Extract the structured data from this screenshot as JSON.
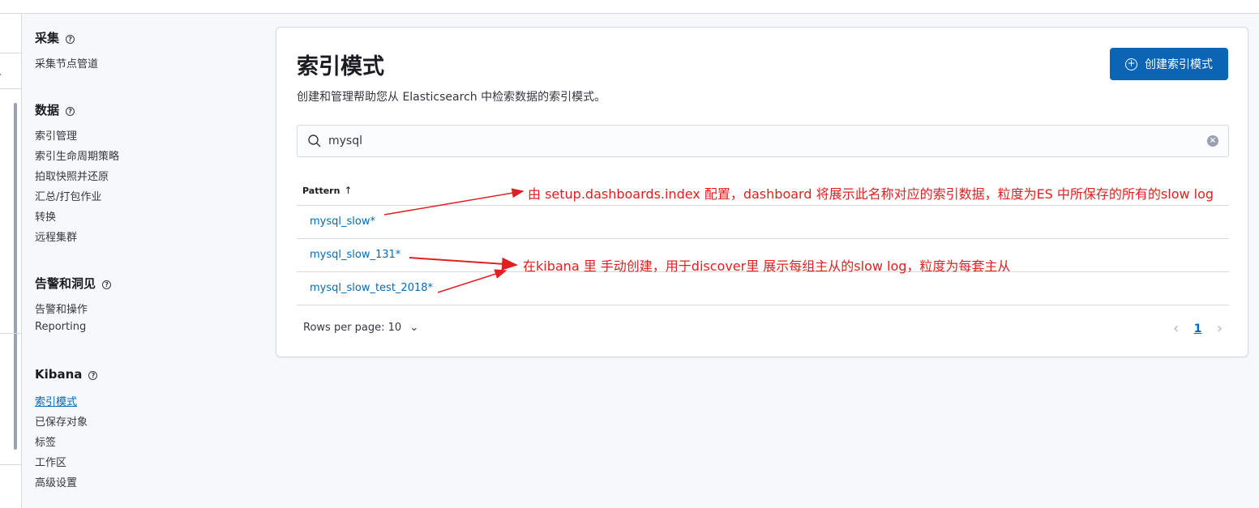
{
  "sidenav": {
    "sections": [
      {
        "title": "采集",
        "items": [
          {
            "label": "采集节点管道"
          }
        ]
      },
      {
        "title": "数据",
        "items": [
          {
            "label": "索引管理"
          },
          {
            "label": "索引生命周期策略"
          },
          {
            "label": "拍取快照并还原"
          },
          {
            "label": "汇总/打包作业"
          },
          {
            "label": "转换"
          },
          {
            "label": "远程集群"
          }
        ]
      },
      {
        "title": "告警和洞见",
        "items": [
          {
            "label": "告警和操作"
          },
          {
            "label": "Reporting"
          }
        ]
      },
      {
        "title": "Kibana",
        "items": [
          {
            "label": "索引模式",
            "active": true
          },
          {
            "label": "已保存对象"
          },
          {
            "label": "标签"
          },
          {
            "label": "工作区"
          },
          {
            "label": "高级设置"
          }
        ]
      }
    ]
  },
  "main": {
    "title": "索引模式",
    "description": "创建和管理帮助您从 Elasticsearch 中检索数据的索引模式。",
    "create_button": "创建索引模式",
    "search": {
      "value": "mysql"
    },
    "table": {
      "column": "Pattern",
      "rows": [
        "mysql_slow*",
        "mysql_slow_131*",
        "mysql_slow_test_2018*"
      ]
    },
    "rows_per_page": "Rows per page: 10",
    "current_page": "1"
  },
  "annotations": {
    "note1": "由 setup.dashboards.index 配置，dashboard 将展示此名称对应的索引数据，粒度为ES 中所保存的所有的slow log",
    "note2": "在kibana 里 手动创建，用于discover里 展示每组主从的slow log，粒度为每套主从",
    "color": "#e02020"
  },
  "colors": {
    "accent": "#0b64b4",
    "link": "#006bb8"
  }
}
